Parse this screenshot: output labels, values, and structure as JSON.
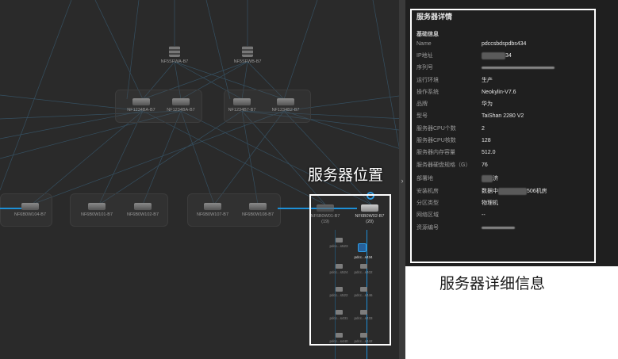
{
  "topology": {
    "firewalls": [
      "NF5SFWA-B7",
      "NF5SFWB-B7"
    ],
    "core_switches": [
      "NF1234BA-B7",
      "NF1234BA-B7",
      "NF1234B7-B7",
      "NF1234B2-B7"
    ],
    "access_switches": [
      "NF6B0W104-B7",
      "NF6B0W101-B7",
      "NF6B0W102-B7",
      "NF6B0W107-B7",
      "NF6B0W108-B7"
    ],
    "position_nodes": {
      "left": "NF6B0W01-B7\n(19)",
      "right": "NF6B0W02-B7\n(20)"
    },
    "servers": [
      "pdcc...s523",
      "pdcc...s434",
      "pdcc...s524",
      "pdcc...s402",
      "pdcc...s522",
      "pdcc...s446",
      "pdcc...s431",
      "pdcc...s433",
      "pdcc...s440",
      "pdcc...s442"
    ]
  },
  "captions": {
    "position": "服务器位置",
    "detail": "服务器详细信息"
  },
  "detail": {
    "title": "服务器详情",
    "section": "基础信息",
    "rows": [
      {
        "k": "Name",
        "v": "pdccsbdspdbs434"
      },
      {
        "k": "IP地址",
        "v": "34"
      },
      {
        "k": "序列号",
        "v": ""
      },
      {
        "k": "运行环境",
        "v": "生产"
      },
      {
        "k": "操作系统",
        "v": "Neokylin-V7.6"
      },
      {
        "k": "品牌",
        "v": "华为"
      },
      {
        "k": "型号",
        "v": "TaiShan 2280 V2"
      },
      {
        "k": "服务器CPU个数",
        "v": "2"
      },
      {
        "k": "服务器CPU核数",
        "v": "128"
      },
      {
        "k": "服务器内存容量",
        "v": "512.0"
      },
      {
        "k": "服务器硬盘规格（G）",
        "v": "76"
      },
      {
        "k": "部署地",
        "v": "济"
      },
      {
        "k": "安装机房",
        "v": "数据中",
        "v2": "506机房"
      },
      {
        "k": "分区类型",
        "v": "物理机"
      },
      {
        "k": "网络区域",
        "v": "--"
      },
      {
        "k": "资源编号",
        "v": ""
      }
    ]
  },
  "colors": {
    "link": "#1d8fd6",
    "highlight_box": "#ffffff",
    "panel_bg": "#1f1f1f",
    "topo_bg": "#2a2a2a"
  }
}
